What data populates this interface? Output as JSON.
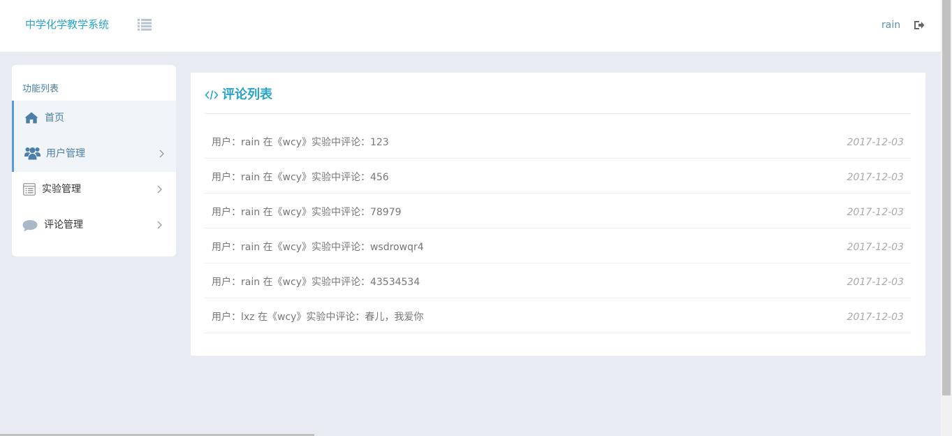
{
  "header": {
    "brand": "中学化学教学系统",
    "user": "rain"
  },
  "sidebar": {
    "title": "功能列表",
    "items": [
      {
        "label": "首页",
        "icon": "home-icon",
        "color": "#4a80a8",
        "active": true,
        "has_arrow": false
      },
      {
        "label": "用户管理",
        "icon": "users-icon",
        "color": "#4a80a8",
        "active": true,
        "has_arrow": true
      },
      {
        "label": "实验管理",
        "icon": "list-alt-icon",
        "color": "#333333",
        "active": false,
        "has_arrow": true
      },
      {
        "label": "评论管理",
        "icon": "comment-icon",
        "color": "#333333",
        "active": false,
        "has_arrow": true
      }
    ]
  },
  "main": {
    "title": "评论列表",
    "comments": [
      {
        "text": "用户：rain 在《wcy》实验中评论：123",
        "date": "2017-12-03"
      },
      {
        "text": "用户：rain 在《wcy》实验中评论：456",
        "date": "2017-12-03"
      },
      {
        "text": "用户：rain 在《wcy》实验中评论：78979",
        "date": "2017-12-03"
      },
      {
        "text": "用户：rain 在《wcy》实验中评论：wsdrowqr4",
        "date": "2017-12-03"
      },
      {
        "text": "用户：rain 在《wcy》实验中评论：43534534",
        "date": "2017-12-03"
      },
      {
        "text": "用户：lxz 在《wcy》实验中评论：春儿，我爱你",
        "date": "2017-12-03"
      }
    ]
  },
  "colors": {
    "accent": "#29a3c9",
    "link": "#4a80a8",
    "background": "#e8ebf2"
  }
}
